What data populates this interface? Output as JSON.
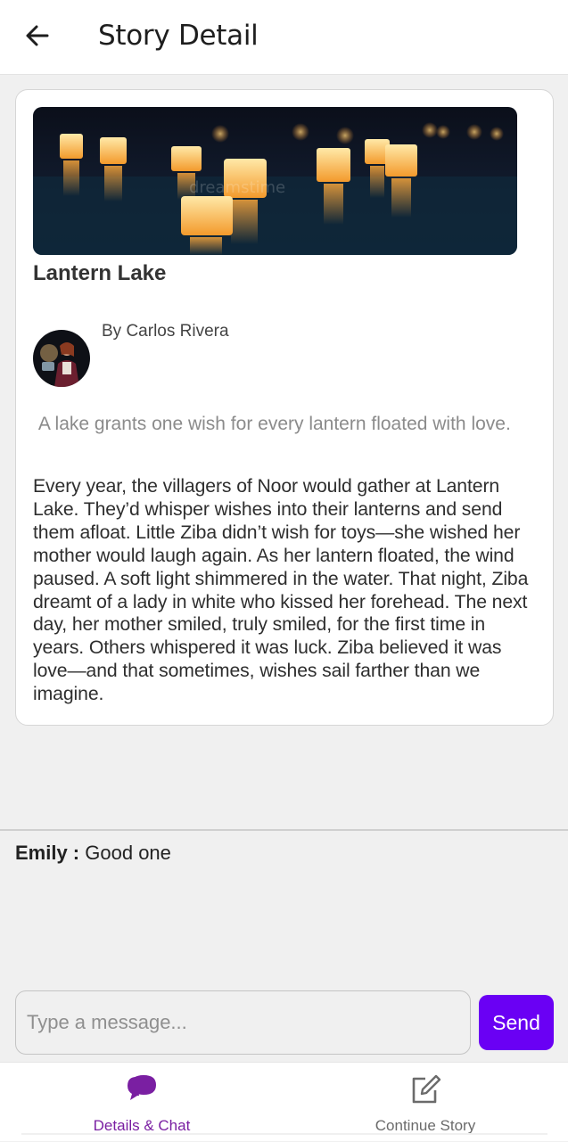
{
  "header": {
    "title": "Story Detail",
    "back_icon": "arrow-left-icon"
  },
  "story": {
    "cover_image": "floating lanterns on lake at night",
    "title": "Lantern Lake",
    "author": "By Carlos Rivera",
    "summary": " A lake grants one wish for every lantern floated with love.",
    "body": "Every year, the villagers of Noor would gather at Lantern Lake. They’d whisper wishes into their lanterns and send them afloat. Little Ziba didn’t wish for toys—she wished her mother would laugh again. As her lantern floated, the wind paused. A soft light shimmered in the water. That night, Ziba dreamt of a lady in white who kissed her forehead. The next day, her mother smiled, truly smiled, for the first time in years. Others whispered it was luck. Ziba believed it was love—and that sometimes, wishes sail farther than we imagine."
  },
  "chat": {
    "messages": [
      {
        "sender": "Emily :",
        "text": "Good one"
      }
    ],
    "input_placeholder": "Type a message...",
    "input_value": "",
    "send_label": "Send"
  },
  "nav": {
    "items": [
      {
        "label": "Details & Chat",
        "icon": "chat-bubbles-icon",
        "active": true
      },
      {
        "label": "Continue Story",
        "icon": "edit-square-icon",
        "active": false
      }
    ]
  },
  "colors": {
    "accent": "#6a00f4",
    "active_nav": "#7a1fa2",
    "background": "#f0f0f0"
  }
}
